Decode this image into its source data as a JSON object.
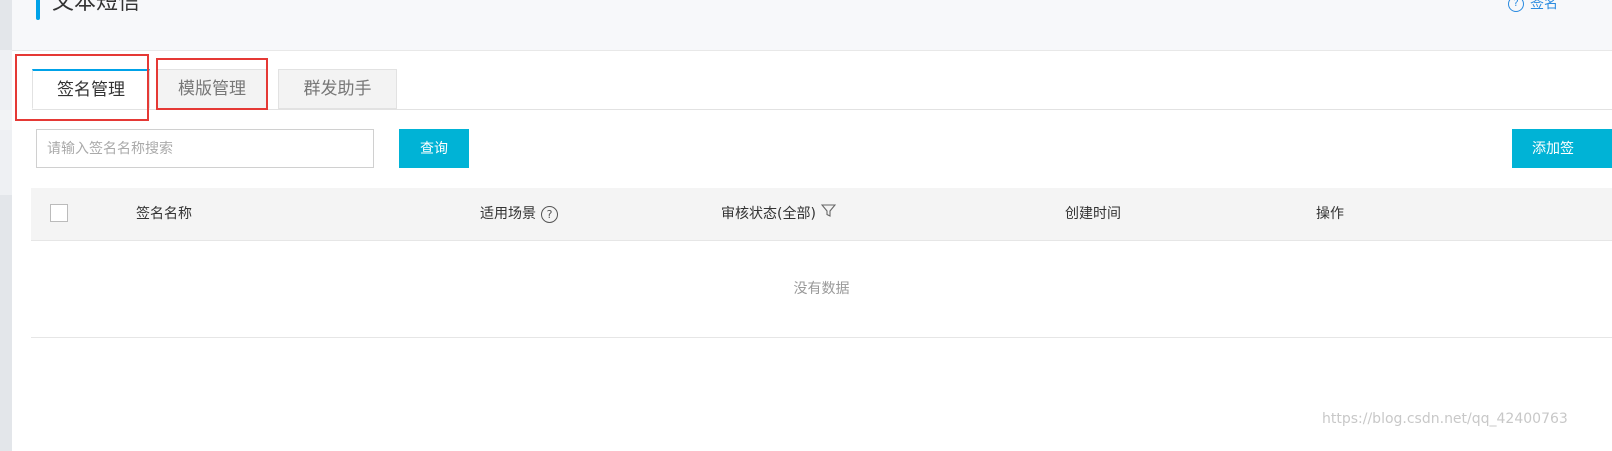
{
  "header": {
    "title": "文本短信",
    "help_label": "签名"
  },
  "tabs": [
    {
      "label": "签名管理",
      "active": true
    },
    {
      "label": "模版管理",
      "active": false
    },
    {
      "label": "群发助手",
      "active": false
    }
  ],
  "search": {
    "placeholder": "请输入签名名称搜索",
    "value": "",
    "query_label": "查询"
  },
  "add_button_label": "添加签",
  "table": {
    "columns": [
      "签名名称",
      "适用场景",
      "审核状态(全部)",
      "创建时间",
      "操作"
    ],
    "empty_text": "没有数据"
  },
  "watermark": "https://blog.csdn.net/qq_42400763",
  "colors": {
    "accent": "#00a2e8",
    "button": "#00b3d6",
    "highlight_box": "#e53935"
  }
}
